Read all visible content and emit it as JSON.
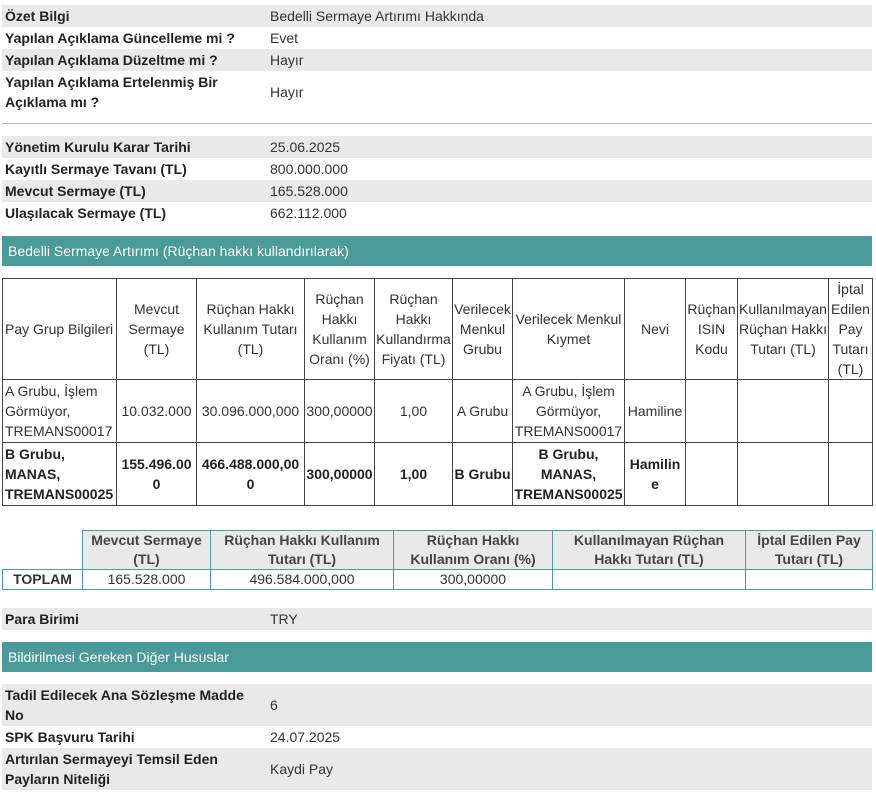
{
  "summary": {
    "rows": [
      {
        "key": "Özet Bilgi",
        "value": "Bedelli Sermaye Artırımı Hakkında"
      },
      {
        "key": "Yapılan Açıklama Güncelleme mi ?",
        "value": "Evet"
      },
      {
        "key": "Yapılan Açıklama Düzeltme mi ?",
        "value": "Hayır"
      },
      {
        "key": "Yapılan Açıklama Ertelenmiş Bir Açıklama mı ?",
        "value": "Hayır"
      }
    ]
  },
  "capital": {
    "rows": [
      {
        "key": "Yönetim Kurulu Karar Tarihi",
        "value": "25.06.2025"
      },
      {
        "key": "Kayıtlı Sermaye Tavanı (TL)",
        "value": "800.000.000"
      },
      {
        "key": "Mevcut Sermaye (TL)",
        "value": "165.528.000"
      },
      {
        "key": "Ulaşılacak Sermaye (TL)",
        "value": "662.112.000"
      }
    ]
  },
  "rights_section": {
    "title": "Bedelli Sermaye Artırımı (Rüçhan hakkı kullandırılarak)",
    "headers": [
      "Pay Grup Bilgileri",
      "Mevcut Sermaye (TL)",
      "Rüçhan Hakkı Kullanım Tutarı (TL)",
      "Rüçhan Hakkı Kullanım Oranı (%)",
      "Rüçhan Hakkı Kullandırma Fiyatı (TL)",
      "Verilecek Menkul Grubu",
      "Verilecek Menkul Kıymet",
      "Nevi",
      "Rüçhan ISIN Kodu",
      "Kullanılmayan Rüçhan Hakkı Tutarı (TL)",
      "İptal Edilen Pay Tutarı (TL)"
    ],
    "rows": [
      [
        "A Grubu, İşlem Görmüyor, TREMANS00017",
        "10.032.000",
        "30.096.000,000",
        "300,00000",
        "1,00",
        "A Grubu",
        "A Grubu, İşlem Görmüyor, TREMANS00017",
        "Hamiline",
        "",
        "",
        ""
      ],
      [
        "B Grubu, MANAS, TREMANS00025",
        "155.496.000",
        "466.488.000,000",
        "300,00000",
        "1,00",
        "B Grubu",
        "B Grubu, MANAS, TREMANS00025",
        "Hamiline",
        "",
        "",
        ""
      ]
    ]
  },
  "totals": {
    "headers": [
      "",
      "Mevcut Sermaye (TL)",
      "Rüçhan Hakkı Kullanım Tutarı (TL)",
      "Rüçhan Hakkı Kullanım Oranı (%)",
      "Kullanılmayan Rüçhan Hakkı Tutarı (TL)",
      "İptal Edilen Pay Tutarı (TL)"
    ],
    "row": [
      "TOPLAM",
      "165.528.000",
      "496.584.000,000",
      "300,00000",
      "",
      ""
    ]
  },
  "currency": {
    "key": "Para Birimi",
    "value": "TRY"
  },
  "other_section": {
    "title": "Bildirilmesi Gereken Diğer Hususlar",
    "rows": [
      {
        "key": "Tadil Edilecek Ana Sözleşme Madde No",
        "value": "6"
      },
      {
        "key": "SPK Başvuru Tarihi",
        "value": "24.07.2025"
      },
      {
        "key": "Artırılan Sermayeyi Temsil Eden Payların Niteliği",
        "value": "Kaydi Pay"
      }
    ]
  },
  "colors": {
    "section_header_bg": "#4a9a9a",
    "row_shade": "#e9e9e9"
  }
}
